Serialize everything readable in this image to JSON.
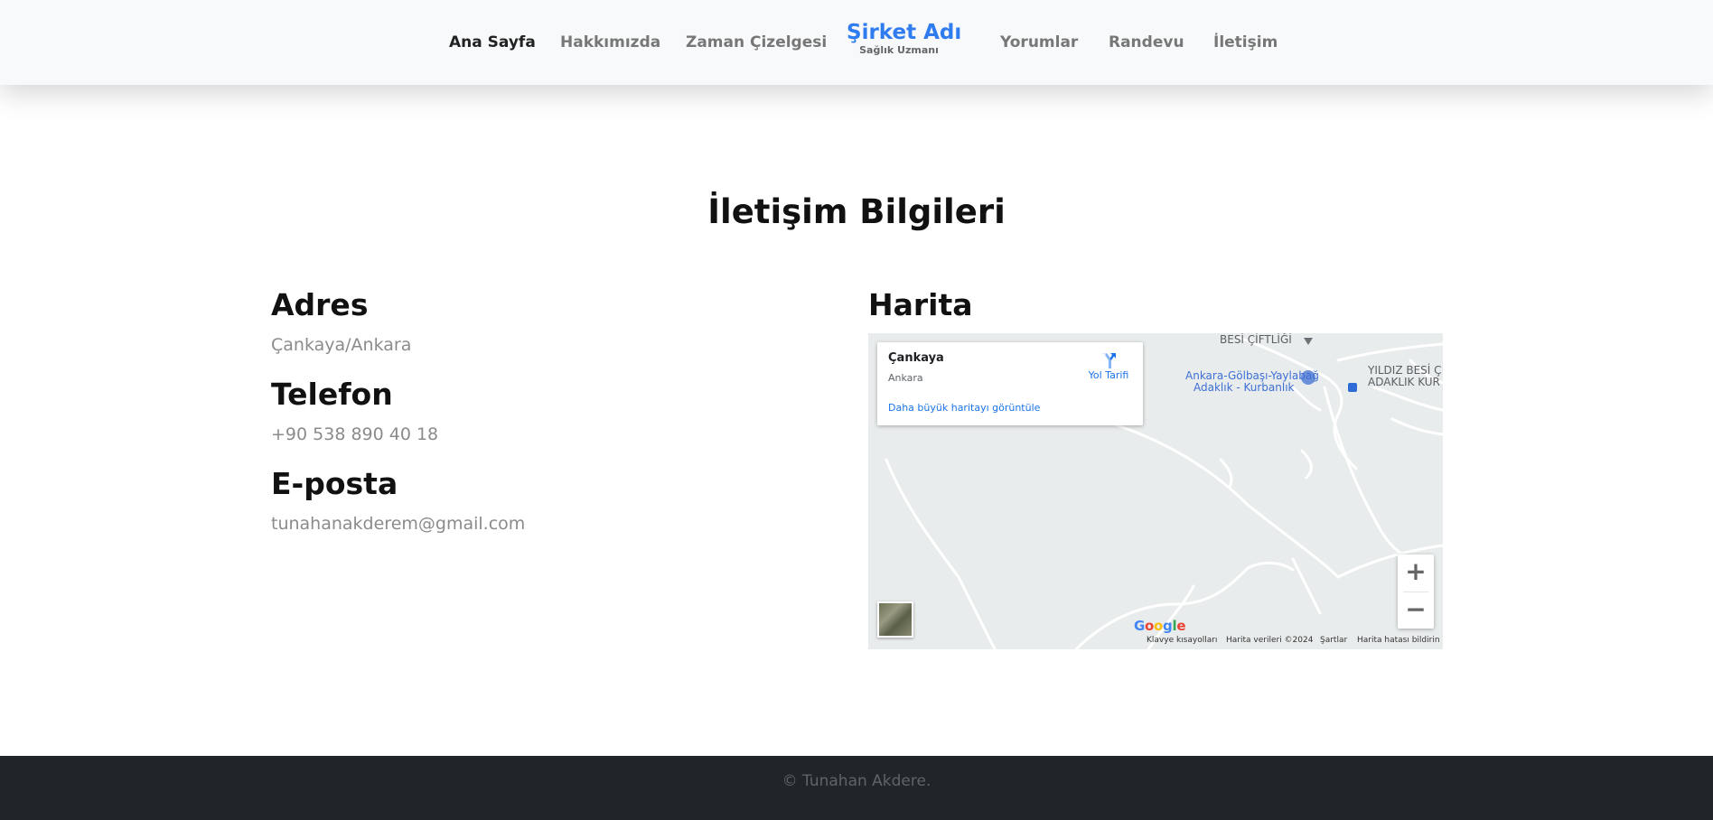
{
  "nav": {
    "items": [
      {
        "label": "Ana Sayfa",
        "active": true
      },
      {
        "label": "Hakkımızda",
        "active": false
      },
      {
        "label": "Zaman Çizelgesi",
        "active": false
      },
      {
        "label": "Yorumlar",
        "active": false
      },
      {
        "label": "Randevu",
        "active": false
      },
      {
        "label": "İletişim",
        "active": false
      }
    ],
    "brand": {
      "title": "Şirket Adı",
      "subtitle": "Sağlık Uzmanı"
    }
  },
  "page": {
    "title": "İletişim Bilgileri"
  },
  "contact": {
    "address_heading": "Adres",
    "address": "Çankaya/Ankara",
    "phone_heading": "Telefon",
    "phone": "+90 538 890 40 18",
    "email_heading": "E-posta",
    "email": "tunahanakderem@gmail.com"
  },
  "map": {
    "heading": "Harita",
    "place_name": "Çankaya",
    "place_region": "Ankara",
    "directions_label": "Yol Tarifi",
    "larger_map_link": "Daha büyük haritayı görüntüle",
    "labels": {
      "farm": "BESİ ÇİFTLİĞİ",
      "poi_line1": "Ankara-Gölbaşı-Yaylabağ",
      "poi_line2": "Adaklık - Kurbanlık",
      "yildiz_line1": "YILDIZ BESİ Ç",
      "yildiz_line2": "ADAKLIK KUR"
    },
    "zoom_in": "+",
    "zoom_out": "−",
    "google": [
      "G",
      "o",
      "o",
      "g",
      "l",
      "e"
    ],
    "google_colors": [
      "#4285F4",
      "#EA4335",
      "#FBBC05",
      "#4285F4",
      "#34A853",
      "#EA4335"
    ],
    "attribution": {
      "shortcuts": "Klavye kısayolları",
      "data": "Harita verileri ©2024",
      "terms": "Şartlar",
      "report": "Harita hatası bildirin"
    }
  },
  "footer": {
    "text": "© Tunahan Akdere."
  },
  "colors": {
    "brand": "#2f7bf0",
    "footer_bg": "#212529",
    "navbar_bg": "#f8f9fa"
  }
}
